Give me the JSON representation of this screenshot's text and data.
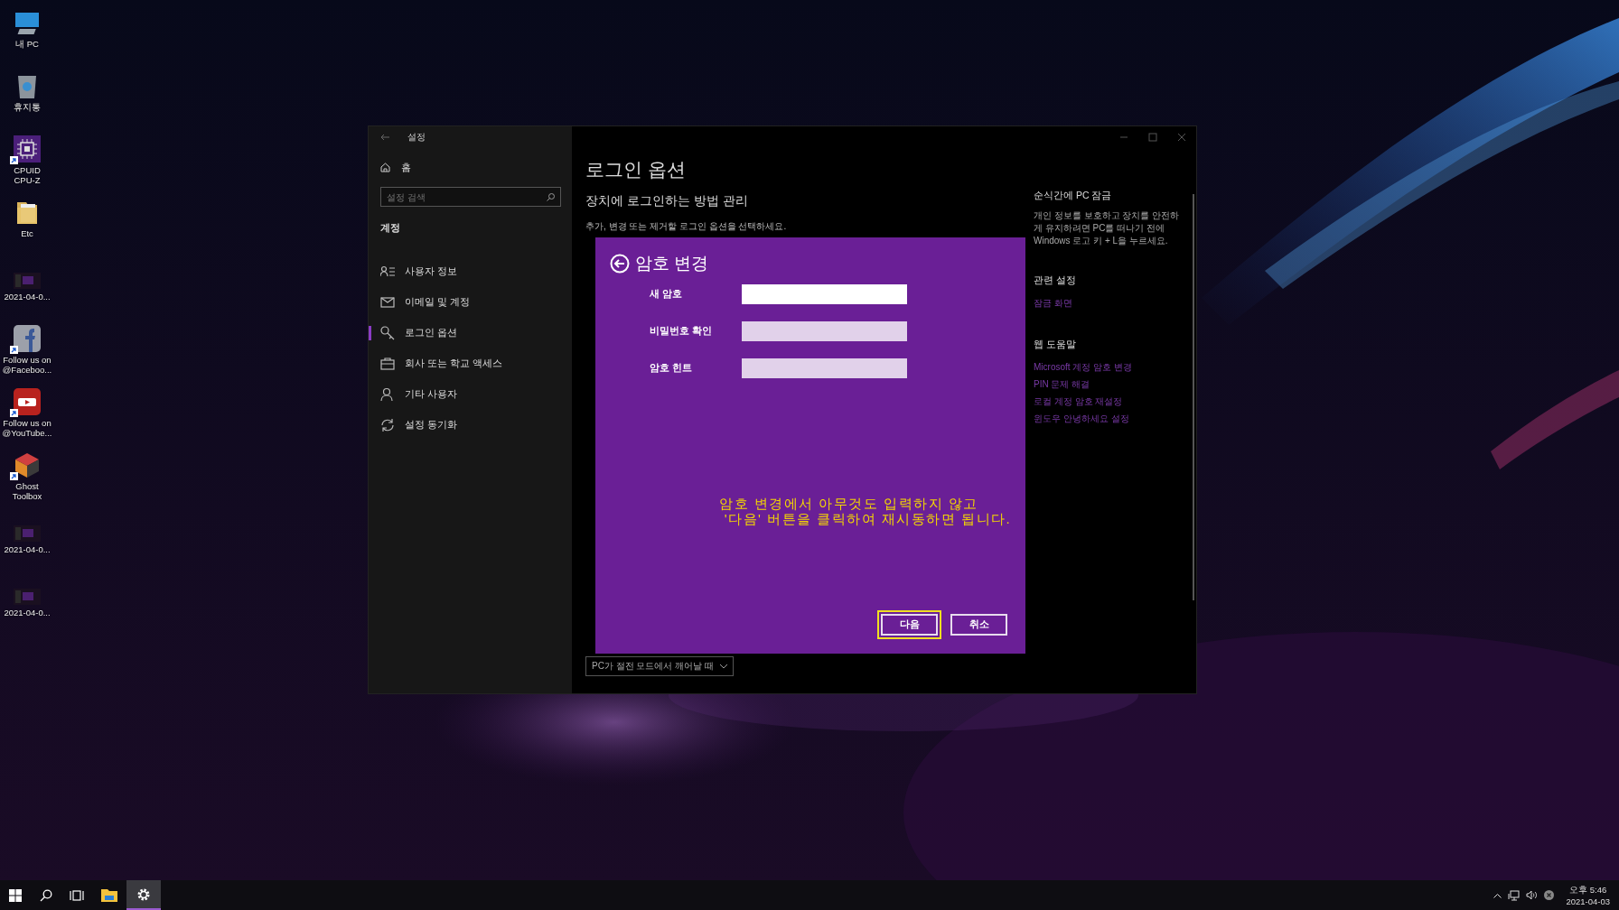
{
  "desktop_icons": [
    {
      "kind": "pc",
      "lines": [
        "내 PC"
      ],
      "shortcut": false
    },
    {
      "kind": "bin",
      "lines": [
        "휴지통"
      ],
      "shortcut": false
    },
    {
      "kind": "chip",
      "lines": [
        "CPUID",
        "CPU-Z"
      ],
      "shortcut": true
    },
    {
      "kind": "folder",
      "lines": [
        "Etc"
      ],
      "shortcut": false
    },
    {
      "kind": "thumb",
      "lines": [
        "2021-04-0..."
      ],
      "shortcut": false
    },
    {
      "kind": "social-f",
      "lines": [
        "Follow us on",
        "@Faceboo..."
      ],
      "shortcut": true
    },
    {
      "kind": "social-play",
      "lines": [
        "Follow us on",
        "@YouTube..."
      ],
      "shortcut": true
    },
    {
      "kind": "cube",
      "lines": [
        "Ghost",
        "Toolbox"
      ],
      "shortcut": true
    },
    {
      "kind": "thumb",
      "lines": [
        "2021-04-0..."
      ],
      "shortcut": false
    },
    {
      "kind": "thumb",
      "lines": [
        "2021-04-0..."
      ],
      "shortcut": false
    }
  ],
  "window": {
    "title": "설정",
    "sidebar": {
      "home": "홈",
      "search": {
        "placeholder": "설정 검색"
      },
      "section": "계정",
      "items": [
        {
          "kind": "user-card",
          "label": "사용자 정보",
          "selected": false
        },
        {
          "kind": "mail",
          "label": "이메일 및 계정",
          "selected": false
        },
        {
          "kind": "key",
          "label": "로그인 옵션",
          "selected": true
        },
        {
          "kind": "briefcase",
          "label": "회사 또는 학교 액세스",
          "selected": false
        },
        {
          "kind": "person",
          "label": "기타 사용자",
          "selected": false
        },
        {
          "kind": "sync",
          "label": "설정 동기화",
          "selected": false
        }
      ]
    },
    "main": {
      "title": "로그인 옵션",
      "subtitle": "장치에 로그인하는 방법 관리",
      "description": "추가, 변경 또는 제거할 로그인 옵션을 선택하세요.",
      "dropdown": {
        "value": "PC가 절전 모드에서 깨어날 때"
      }
    },
    "aside": [
      {
        "heading": "순식간에 PC 잠금",
        "text": "개인 정보를 보호하고 장치를 안전하게 유지하려면 PC를 떠나기 전에 Windows 로고 키 + L을 누르세요."
      },
      {
        "heading": "관련 설정",
        "links": [
          "잠금 화면"
        ]
      },
      {
        "heading": "웹 도움말",
        "links": [
          "Microsoft 계정 암호 변경",
          "PIN 문제 해결",
          "로컬 계정 암호 재설정",
          "윈도우 안녕하세요 설정"
        ]
      }
    ]
  },
  "dialog": {
    "title": "암호 변경",
    "fields": [
      {
        "label": "새 암호",
        "focused": true
      },
      {
        "label": "비밀번호 확인",
        "focused": false
      },
      {
        "label": "암호 힌트",
        "focused": false
      }
    ],
    "note": [
      "암호 변경에서 아무것도 입력하지 않고",
      "'다음' 버튼을 클릭하여 재시동하면 됩니다."
    ],
    "buttons": [
      {
        "label": "다음",
        "selected": true
      },
      {
        "label": "취소",
        "selected": false
      }
    ]
  },
  "taskbar": {
    "items": [
      {
        "kind": "start",
        "active": false
      },
      {
        "kind": "search",
        "active": false
      },
      {
        "kind": "taskview",
        "active": false
      },
      {
        "kind": "explorer",
        "active": false
      },
      {
        "kind": "settings",
        "active": true
      }
    ],
    "clock": {
      "time": "오후 5:46",
      "date": "2021-04-03"
    }
  }
}
